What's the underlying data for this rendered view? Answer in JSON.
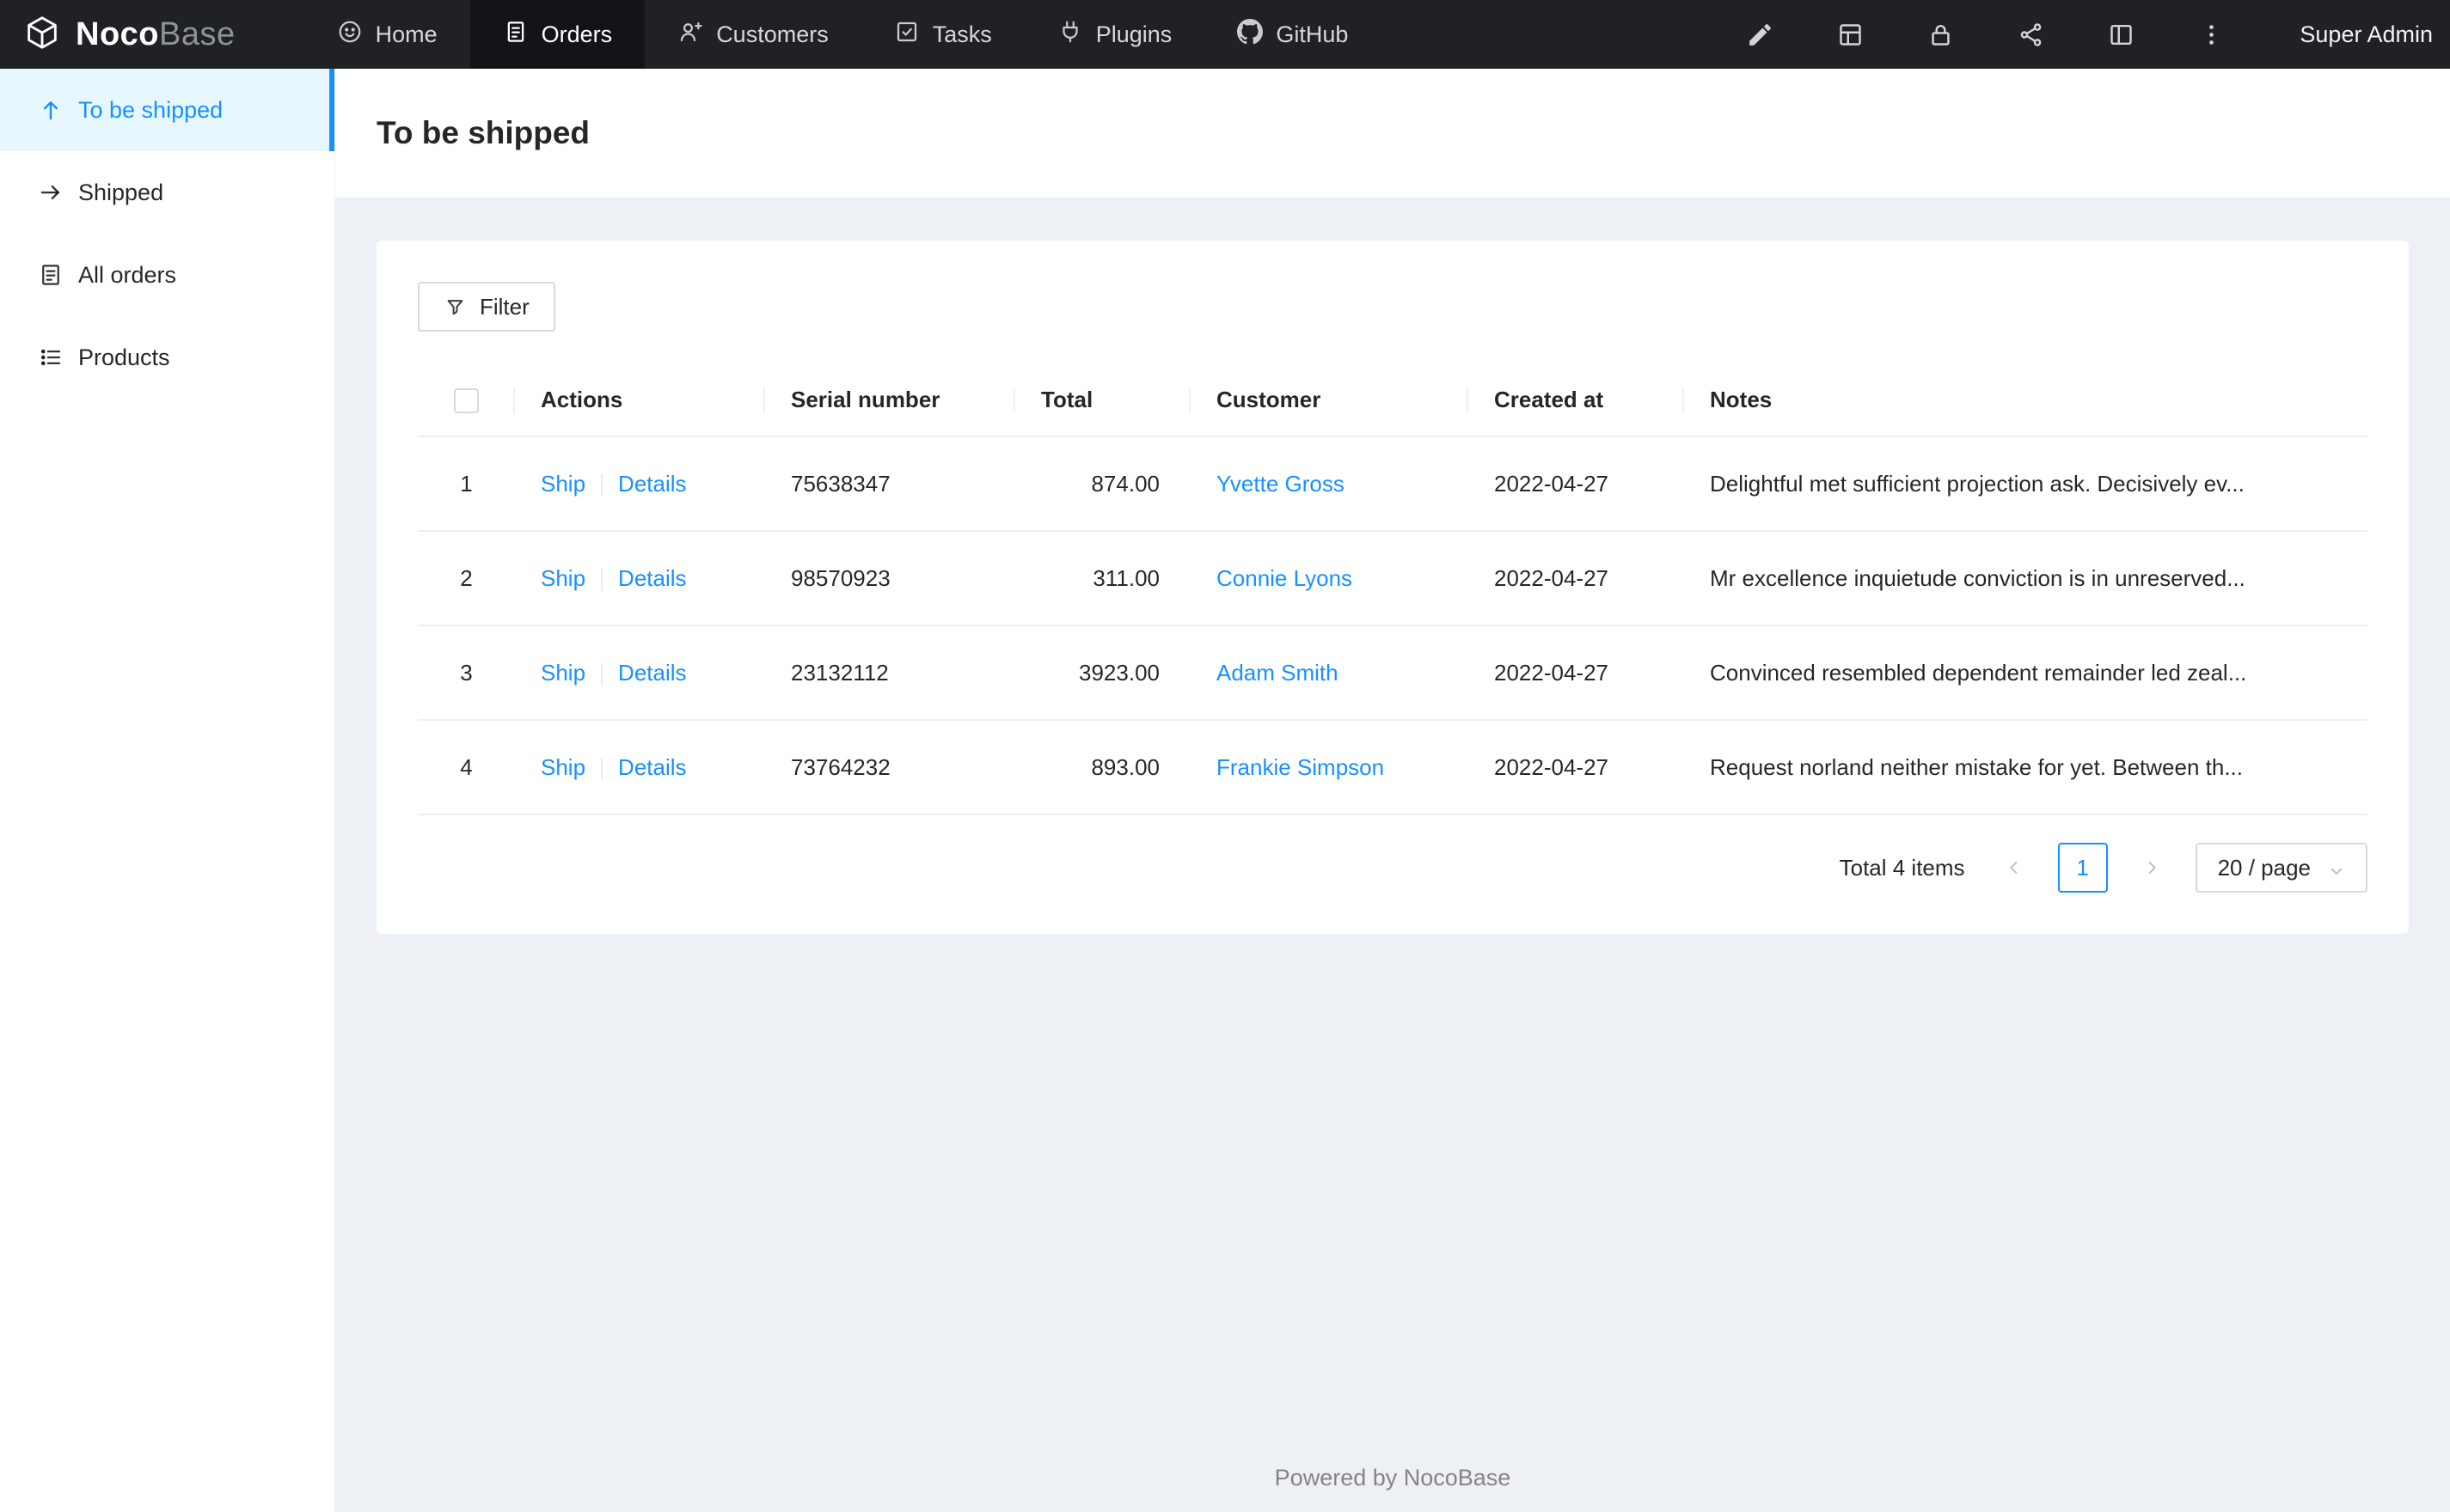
{
  "navbar": {
    "brand_primary": "Noco",
    "brand_secondary": "Base",
    "items": [
      {
        "label": "Home"
      },
      {
        "label": "Orders"
      },
      {
        "label": "Customers"
      },
      {
        "label": "Tasks"
      },
      {
        "label": "Plugins"
      },
      {
        "label": "GitHub"
      }
    ],
    "user": "Super Admin"
  },
  "sidebar": {
    "items": [
      {
        "label": "To be shipped"
      },
      {
        "label": "Shipped"
      },
      {
        "label": "All orders"
      },
      {
        "label": "Products"
      }
    ]
  },
  "page": {
    "title": "To be shipped"
  },
  "toolbar": {
    "filter": "Filter"
  },
  "table": {
    "columns": [
      "Actions",
      "Serial number",
      "Total",
      "Customer",
      "Created at",
      "Notes"
    ],
    "rows": [
      {
        "index": "1",
        "action_ship": "Ship",
        "action_details": "Details",
        "serial": "75638347",
        "total": "874.00",
        "customer": "Yvette Gross",
        "created": "2022-04-27",
        "notes": "Delightful met sufficient projection ask. Decisively ev..."
      },
      {
        "index": "2",
        "action_ship": "Ship",
        "action_details": "Details",
        "serial": "98570923",
        "total": "311.00",
        "customer": "Connie Lyons",
        "created": "2022-04-27",
        "notes": "Mr excellence inquietude conviction is in unreserved..."
      },
      {
        "index": "3",
        "action_ship": "Ship",
        "action_details": "Details",
        "serial": "23132112",
        "total": "3923.00",
        "customer": "Adam Smith",
        "created": "2022-04-27",
        "notes": "Convinced resembled dependent remainder led zeal..."
      },
      {
        "index": "4",
        "action_ship": "Ship",
        "action_details": "Details",
        "serial": "73764232",
        "total": "893.00",
        "customer": "Frankie Simpson",
        "created": "2022-04-27",
        "notes": "Request norland neither mistake for yet. Between th..."
      }
    ]
  },
  "pagination": {
    "total": "Total 4 items",
    "page": "1",
    "size": "20 / page"
  },
  "footer": {
    "text": "Powered by NocoBase"
  },
  "icons": {
    "nocobase-logo": "cube wireframe",
    "home-icon": "smiley circle",
    "orders-icon": "document",
    "customers-icon": "user-add",
    "tasks-icon": "check-square",
    "plugins-icon": "plug",
    "github-icon": "github mark",
    "ui-editor-icon": "highlighter pen",
    "collections-icon": "table grid",
    "permissions-icon": "lock",
    "api-icon": "share nodes",
    "layout-icon": "split layout",
    "more-icon": "vertical ellipsis",
    "filter-icon": "funnel",
    "chevron-left-icon": "pagination previous",
    "chevron-right-icon": "pagination next",
    "chevron-down-icon": "select caret"
  },
  "colors": {
    "accent": "#1890ff",
    "navbar_bg": "#1f2124",
    "navbar_active_bg": "#121417",
    "sidebar_active_bg": "#e6f7ff",
    "content_bg": "#edf0f4",
    "border": "#f0f0f0"
  }
}
